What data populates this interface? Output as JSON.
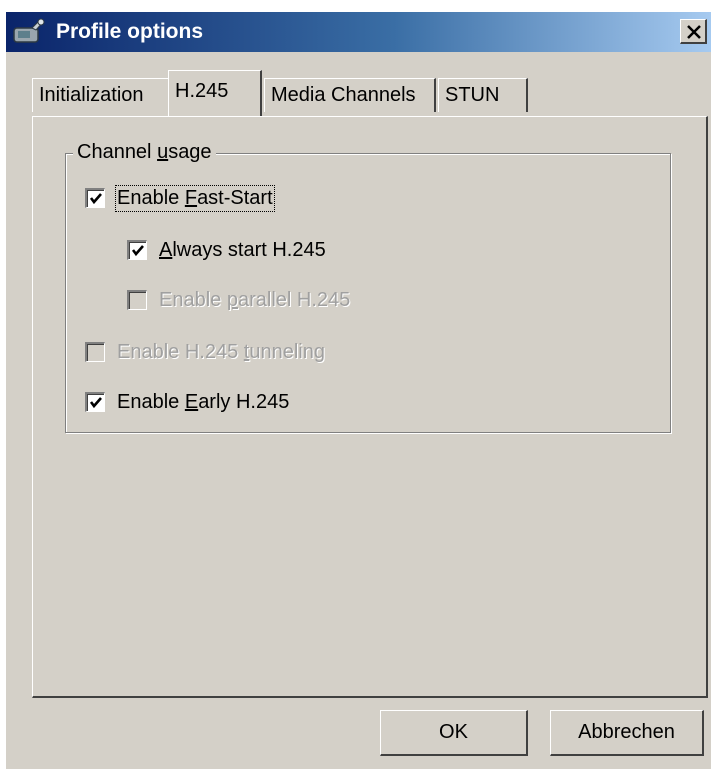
{
  "window": {
    "title": "Profile options",
    "close_glyph": "×",
    "app_icon": "satellite-phone-icon"
  },
  "tabs": [
    {
      "label": "Initialization",
      "selected": false
    },
    {
      "label": "H.245",
      "selected": true
    },
    {
      "label": "Media Channels",
      "selected": false
    },
    {
      "label": "STUN",
      "selected": false
    }
  ],
  "group": {
    "legend_pre": "Channel ",
    "legend_mnemonic": "u",
    "legend_post": "sage"
  },
  "options": {
    "fast_start": {
      "pre": "Enable ",
      "mnemonic": "F",
      "post": "ast-Start",
      "checked": true,
      "enabled": true
    },
    "always_start": {
      "pre": "",
      "mnemonic": "A",
      "post": "lways start H.245",
      "checked": true,
      "enabled": true
    },
    "parallel": {
      "pre": "Enable ",
      "mnemonic": "p",
      "post": "arallel H.245",
      "checked": false,
      "enabled": false
    },
    "tunneling": {
      "pre": "Enable H.245 ",
      "mnemonic": "t",
      "post": "unneling",
      "checked": false,
      "enabled": false
    },
    "early": {
      "pre": "Enable ",
      "mnemonic": "E",
      "post": "arly H.245",
      "checked": true,
      "enabled": true
    }
  },
  "buttons": {
    "ok": "OK",
    "cancel": "Abbrechen"
  },
  "colors": {
    "face": "#d4d0c8",
    "title_start": "#0a246a",
    "title_end": "#a6caf0",
    "disabled_text": "#a0a0a0"
  }
}
